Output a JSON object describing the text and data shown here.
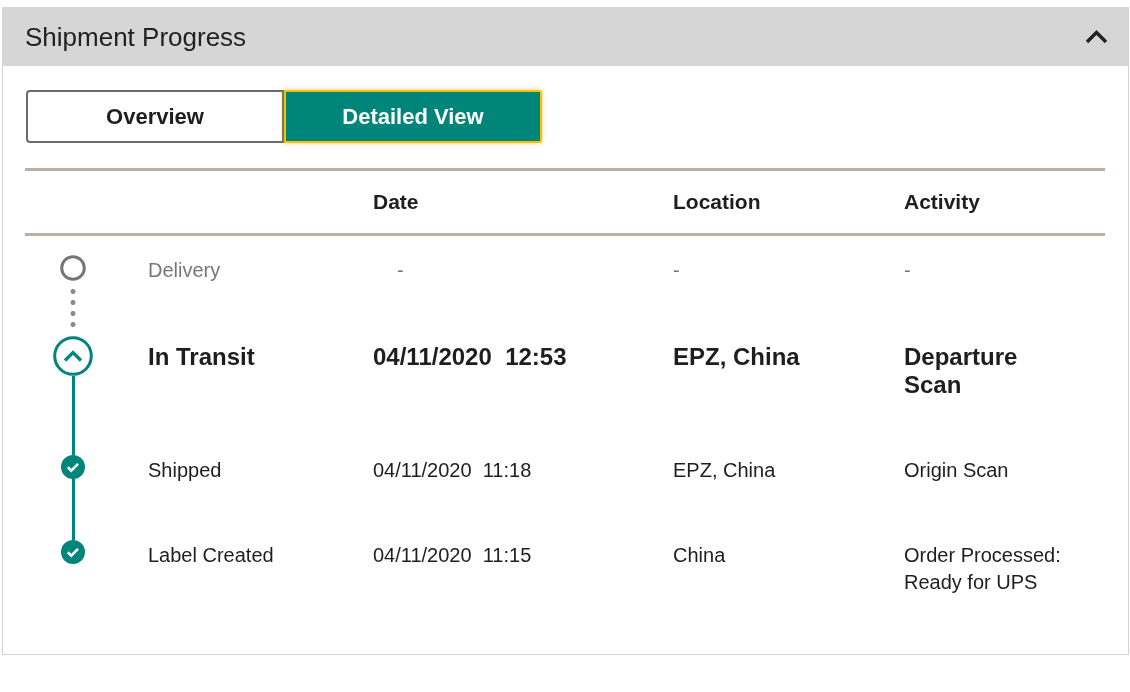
{
  "panel": {
    "title": "Shipment Progress",
    "expanded": true
  },
  "tabs": [
    {
      "label": "Overview",
      "selected": false
    },
    {
      "label": "Detailed View",
      "selected": true
    }
  ],
  "table": {
    "columns": [
      "Date",
      "Location",
      "Activity"
    ],
    "rows": [
      {
        "kind": "pending",
        "label": "Delivery",
        "date": "-",
        "location": "-",
        "activity": "-"
      },
      {
        "kind": "current",
        "label": "In Transit",
        "date": "04/11/2020  12:53",
        "location": "EPZ, China",
        "activity": "Departure Scan"
      },
      {
        "kind": "done",
        "label": "Shipped",
        "date": "04/11/2020  11:18",
        "location": "EPZ, China",
        "activity": "Origin Scan"
      },
      {
        "kind": "done",
        "label": "Label Created",
        "date": "04/11/2020  11:15",
        "location": "China",
        "activity": "Order Processed: Ready for UPS"
      }
    ]
  }
}
